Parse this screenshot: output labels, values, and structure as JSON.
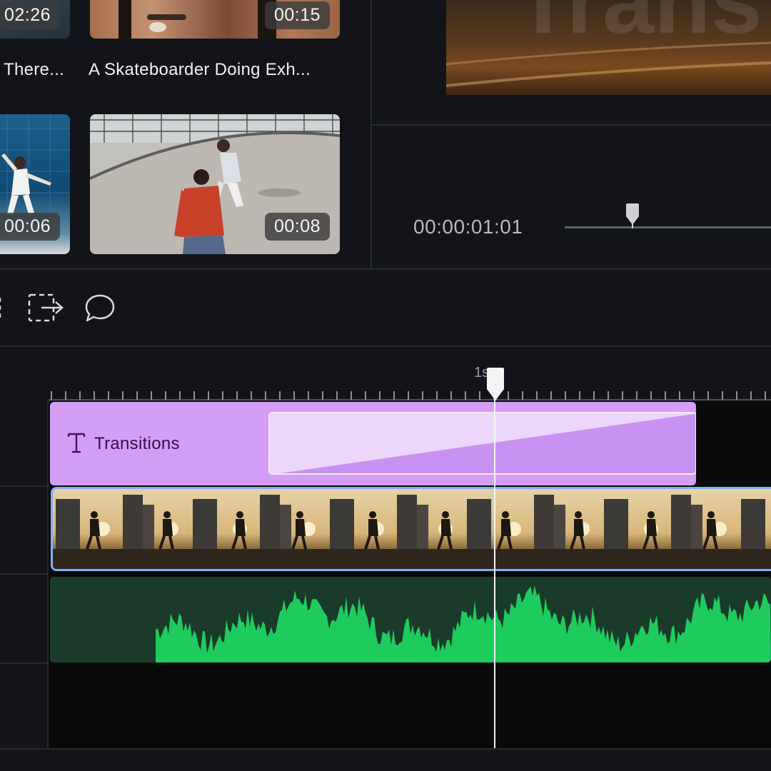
{
  "media_library": {
    "clips": [
      {
        "title": "There...",
        "duration": "02:26",
        "thumb": "partial-clip-top-left"
      },
      {
        "title": "A Skateboarder Doing Exh...",
        "duration": "00:15",
        "thumb": "skateboard-closeup"
      },
      {
        "title": "",
        "duration": "00:06",
        "thumb": "man-dancing-blue-wall"
      },
      {
        "title": "",
        "duration": "00:08",
        "thumb": "skate-park-people"
      }
    ]
  },
  "preview": {
    "overlay_text": "Trans",
    "timecode": "00:00:01:01",
    "scrubber_progress": 0.33
  },
  "toolbar": {
    "icons": [
      "crop-icon",
      "export-icon",
      "comment-icon"
    ]
  },
  "timeline": {
    "ruler_label": "1s",
    "text_track_label": "Transitions",
    "colors": {
      "text_track": "#d49ef7",
      "video_border": "#7fb2f2",
      "audio_wave": "#1ecb5d",
      "audio_bg": "#1a3a2a"
    }
  }
}
